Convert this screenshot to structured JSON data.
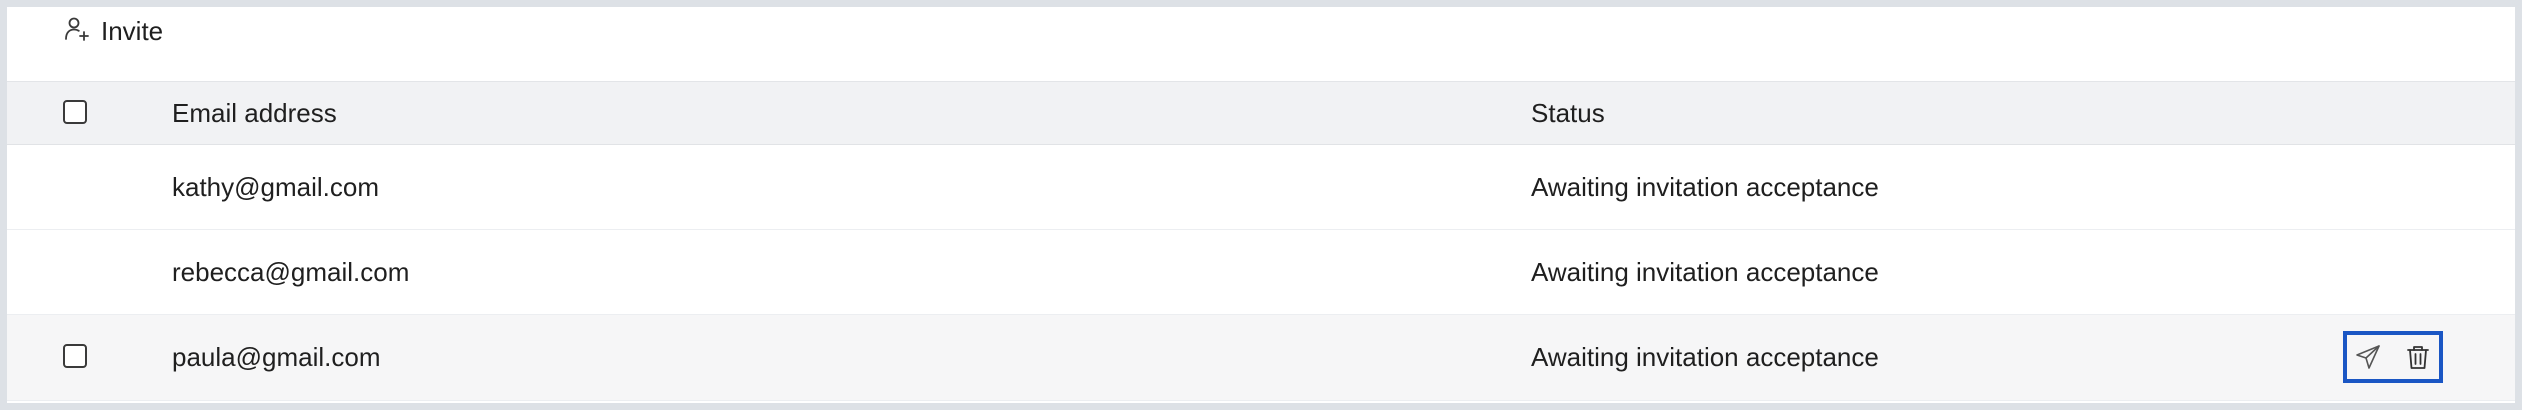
{
  "toolbar": {
    "invite_label": "Invite",
    "invite_icon": "person-plus-icon"
  },
  "table": {
    "columns": [
      "Email address",
      "Status"
    ],
    "rows": [
      {
        "email": "kathy@gmail.com",
        "status": "Awaiting invitation acceptance"
      },
      {
        "email": "rebecca@gmail.com",
        "status": "Awaiting invitation acceptance"
      },
      {
        "email": "paula@gmail.com",
        "status": "Awaiting invitation acceptance"
      }
    ],
    "row_actions": {
      "resend_icon": "send-icon",
      "delete_icon": "trash-icon"
    }
  },
  "colors": {
    "header_bg": "#f1f2f4",
    "highlight_border": "#1a56c4",
    "hover_row_bg": "#f6f6f7"
  }
}
